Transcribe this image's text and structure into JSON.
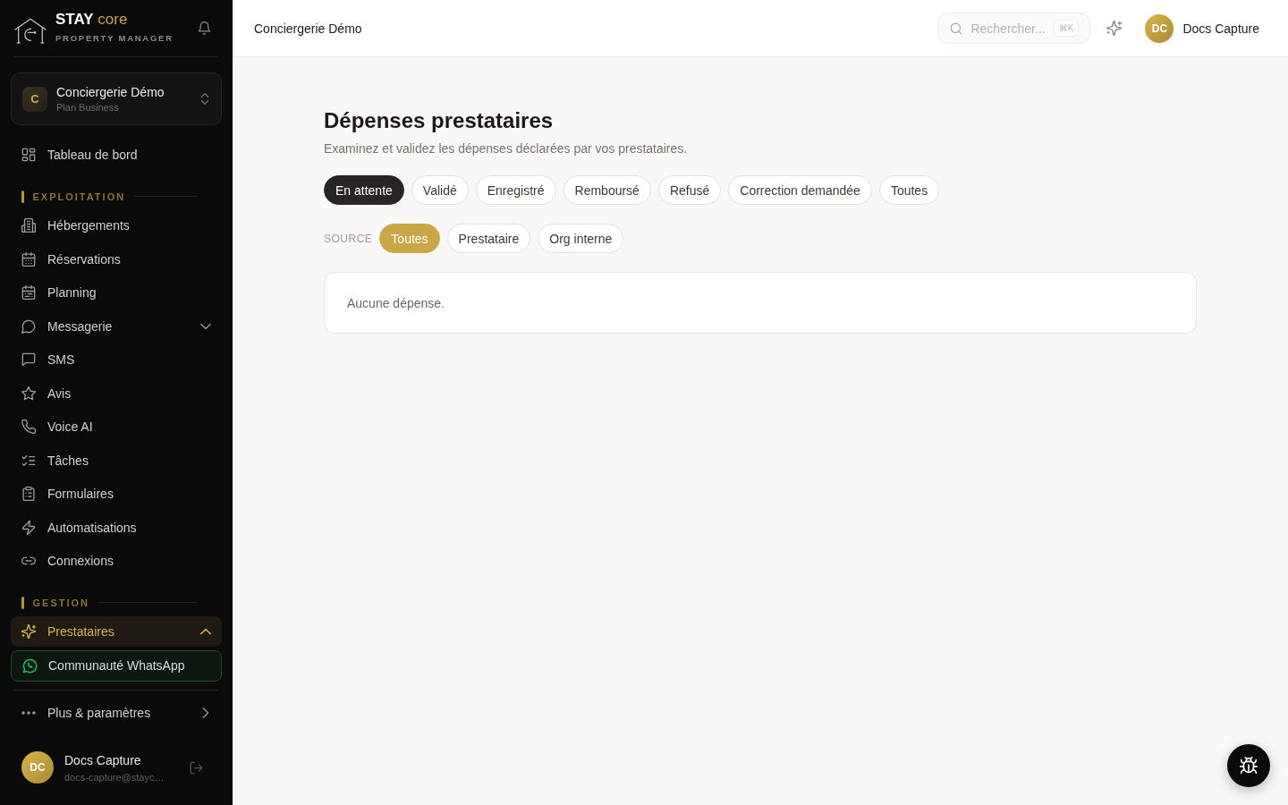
{
  "sidebar": {
    "brand": {
      "name": "STAY",
      "accent": "core",
      "tagline": "PROPERTY MANAGER"
    },
    "organization": {
      "initial": "C",
      "name": "Conciergerie Démo",
      "plan": "Plan Business"
    },
    "nav": [
      {
        "kind": "link",
        "label": "Tableau de bord",
        "selected": false
      },
      {
        "kind": "section",
        "title": "EXPLOITATION"
      },
      {
        "kind": "link",
        "label": "Hébergements",
        "selected": false
      },
      {
        "kind": "link",
        "label": "Réservations",
        "selected": false
      },
      {
        "kind": "link",
        "label": "Planning",
        "selected": false
      },
      {
        "kind": "group",
        "label": "Messagerie",
        "selected": false,
        "expanded": false
      },
      {
        "kind": "link",
        "label": "SMS",
        "selected": false
      },
      {
        "kind": "link",
        "label": "Avis",
        "selected": false
      },
      {
        "kind": "link",
        "label": "Voice AI",
        "selected": false
      },
      {
        "kind": "link",
        "label": "Tâches",
        "selected": false
      },
      {
        "kind": "link",
        "label": "Formulaires",
        "selected": false
      },
      {
        "kind": "link",
        "label": "Automatisations",
        "selected": false
      },
      {
        "kind": "link",
        "label": "Connexions",
        "selected": false
      },
      {
        "kind": "section",
        "title": "GESTION"
      },
      {
        "kind": "group",
        "label": "Prestataires",
        "selected": true,
        "expanded": true
      },
      {
        "kind": "community",
        "label": "Communauté WhatsApp",
        "selected": false
      }
    ],
    "more": {
      "label": "Plus & paramètres"
    },
    "user": {
      "initials": "DC",
      "name": "Docs Capture",
      "email": "docs-capture@stayc…"
    }
  },
  "topbar": {
    "title": "Conciergerie Démo",
    "search": {
      "placeholder": "Rechercher...",
      "shortcut": "⌘K"
    },
    "user": {
      "initials": "DC",
      "name": "Docs Capture"
    }
  },
  "page": {
    "title": "Dépenses prestataires",
    "subtitle": "Examinez et validez les dépenses déclarées par vos prestataires.",
    "status_filters": [
      {
        "label": "En attente",
        "selected": true
      },
      {
        "label": "Validé",
        "selected": false
      },
      {
        "label": "Enregistré",
        "selected": false
      },
      {
        "label": "Remboursé",
        "selected": false
      },
      {
        "label": "Refusé",
        "selected": false
      },
      {
        "label": "Correction demandée",
        "selected": false
      },
      {
        "label": "Toutes",
        "selected": false
      }
    ],
    "source_filter": {
      "label": "SOURCE",
      "options": [
        {
          "label": "Toutes",
          "selected": true
        },
        {
          "label": "Prestataire",
          "selected": false
        },
        {
          "label": "Org interne",
          "selected": false
        }
      ]
    },
    "empty_message": "Aucune dépense."
  }
}
